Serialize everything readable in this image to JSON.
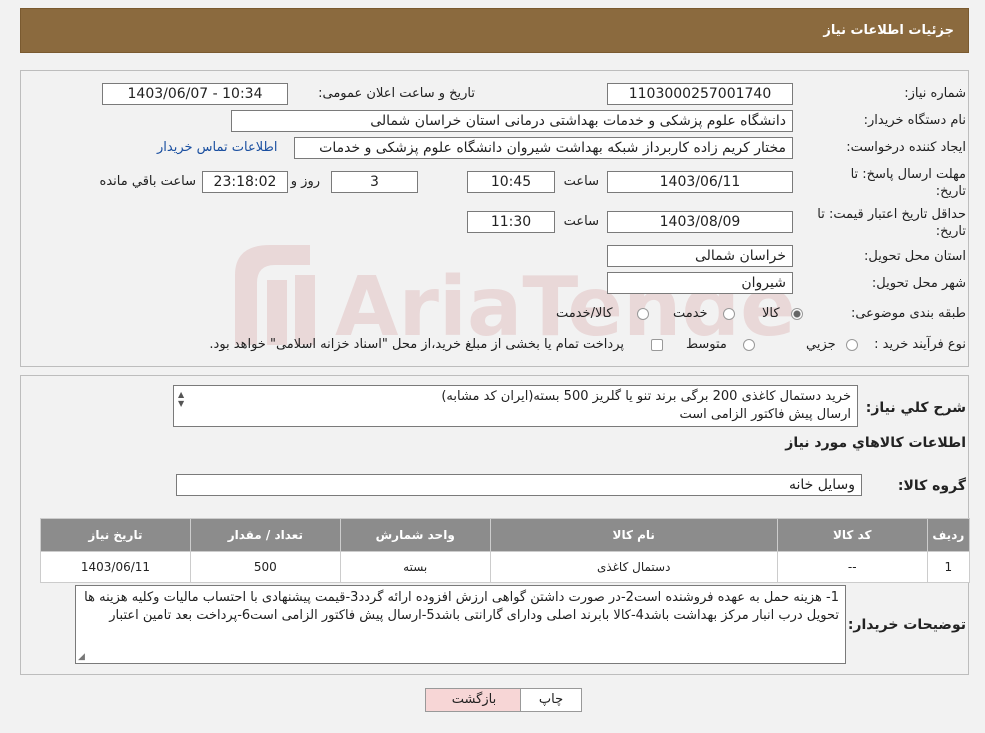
{
  "header": {
    "title": "جزئیات اطلاعات نیاز"
  },
  "form": {
    "need_number": {
      "label": "شماره نیاز:",
      "value": "1103000257001740"
    },
    "announce": {
      "label": "تاریخ و ساعت اعلان عمومی:",
      "value": "1403/06/07 - 10:34"
    },
    "buyer_org": {
      "label": "نام دستگاه خریدار:",
      "value": "دانشگاه علوم پزشکی و خدمات بهداشتی درمانی استان خراسان شمالی"
    },
    "requester": {
      "label": "ایجاد کننده درخواست:",
      "value": "مختار کریم زاده کاربرداز شبکه بهداشت شیروان دانشگاه علوم پزشکی و خدمات",
      "link": "اطلاعات تماس خریدار"
    },
    "reply_deadline": {
      "label_1": "مهلت ارسال پاسخ: تا",
      "label_2": "تاریخ:",
      "date": "1403/06/11",
      "time_label": "ساعت",
      "time": "10:45",
      "days": "3",
      "days_label": "روز و",
      "remaining": "23:18:02",
      "remaining_label": "ساعت باقي مانده"
    },
    "price_validity": {
      "label_1": "حداقل تاریخ اعتبار قیمت: تا",
      "label_2": "تاریخ:",
      "date": "1403/08/09",
      "time_label": "ساعت",
      "time": "11:30"
    },
    "province": {
      "label": "استان محل تحویل:",
      "value": "خراسان شمالی"
    },
    "city": {
      "label": "شهر محل تحویل:",
      "value": "شیروان"
    },
    "category": {
      "label": "طبقه بندی موضوعی:",
      "options": [
        "کالا",
        "خدمت",
        "کالا/خدمت"
      ]
    },
    "process": {
      "label": "نوع فرآیند خرید :",
      "options": [
        "جزيي",
        "متوسط"
      ],
      "note": "پرداخت تمام یا بخشی از مبلغ خرید،از محل \"اسناد خزانه اسلامی\" خواهد بود."
    }
  },
  "description": {
    "label": "شرح كلي نياز:",
    "line1": "خرید دستمال کاغذی 200 برگی برند تنو یا گلریز 500 بسته(ایران کد مشابه)",
    "line2": "ارسال پیش فاکتور الزامی است"
  },
  "goods_section": {
    "title": "اطلاعات كالاهاي مورد نياز",
    "group_label": "گروه کالا:",
    "group_value": "وسایل خانه"
  },
  "table": {
    "headers": [
      "رديف",
      "کد کالا",
      "نام کالا",
      "واحد شمارش",
      "تعداد / مقدار",
      "تاریخ نیاز"
    ],
    "rows": [
      [
        "1",
        "--",
        "دستمال کاغذی",
        "بسته",
        "500",
        "1403/06/11"
      ]
    ]
  },
  "buyer_notes": {
    "label": "توضیحات خریدار:",
    "text": "1- هزینه حمل به عهده فروشنده است2-در صورت داشتن گواهی ارزش افزوده ارائه گردد3-قیمت پیشنهادی با احتساب مالیات وکلیه هزینه ها تحویل درب انبار مرکز بهداشت  باشد4-کالا بابرند اصلی ودارای گارانتی  باشد5-ارسال پیش فاکتور الزامی است6-پرداخت بعد تامین اعتبار"
  },
  "buttons": {
    "print": "چاپ",
    "back": "بازگشت"
  },
  "watermark": {
    "text": "AriaTender.neT"
  },
  "colors": {
    "header": "#8b6a3e",
    "table_header": "#8c8c8c",
    "back_button": "#f7d6d6",
    "link": "#1a4fa0"
  }
}
